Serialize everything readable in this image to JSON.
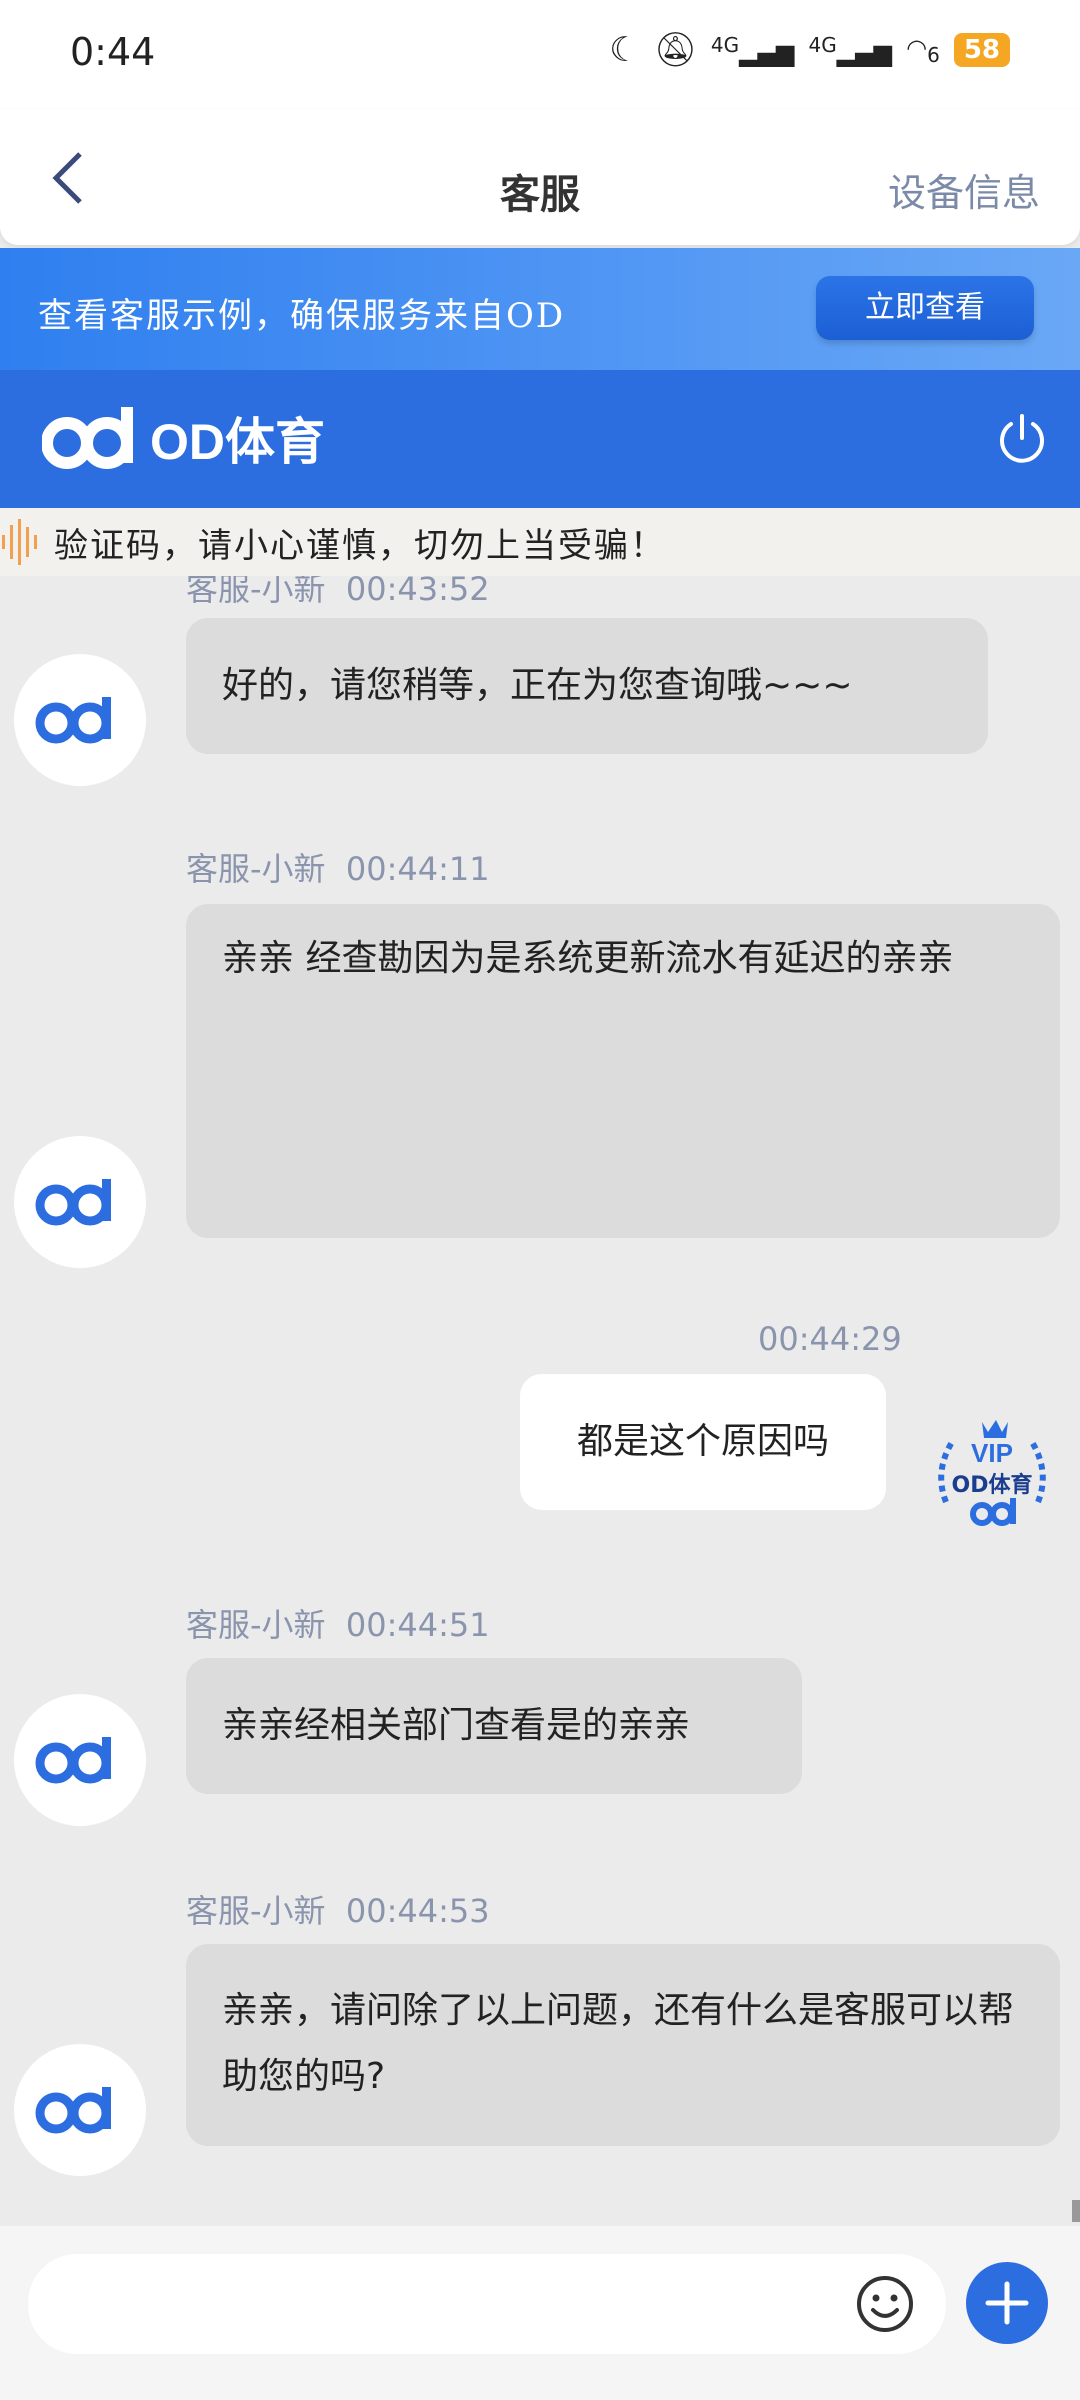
{
  "status_bar": {
    "time": "0:44",
    "network_1": "4G",
    "network_2": "4G",
    "wifi_label": "6",
    "battery": "58"
  },
  "header": {
    "back_icon": "chevron-left-icon",
    "title": "客服",
    "device_info": "设备信息"
  },
  "promo": {
    "text": "查看客服示例，确保服务来自OD",
    "button": "立即查看"
  },
  "brand": {
    "name": "OD体育",
    "logo_text": "od",
    "power_icon": "power-icon"
  },
  "notice": {
    "text": "验证码，请小心谨慎，切勿上当受骗！"
  },
  "messages": [
    {
      "sender": "客服-小新",
      "time": "00:43:52",
      "text": "好的，请您稍等，正在为您查询哦~~~"
    },
    {
      "sender": "客服-小新",
      "time": "00:44:11",
      "text": "亲亲 经查勘因为是系统更新流水有延迟的亲亲"
    },
    {
      "sender": "",
      "time": "00:44:29",
      "text": "都是这个原因吗",
      "self_avatar_text": "VIP",
      "self_avatar_brand": "OD体育"
    },
    {
      "sender": "客服-小新",
      "time": "00:44:51",
      "text": "亲亲经相关部门查看是的亲亲"
    },
    {
      "sender": "客服-小新",
      "time": "00:44:53",
      "text": "亲亲，请问除了以上问题，还有什么是客服可以帮助您的吗?"
    }
  ],
  "input": {
    "placeholder": "",
    "emoji_icon": "emoji-icon",
    "plus_icon": "plus-icon"
  },
  "colors": {
    "brand_blue": "#2c6ee0",
    "bubble_gray": "#dcdcdc"
  }
}
